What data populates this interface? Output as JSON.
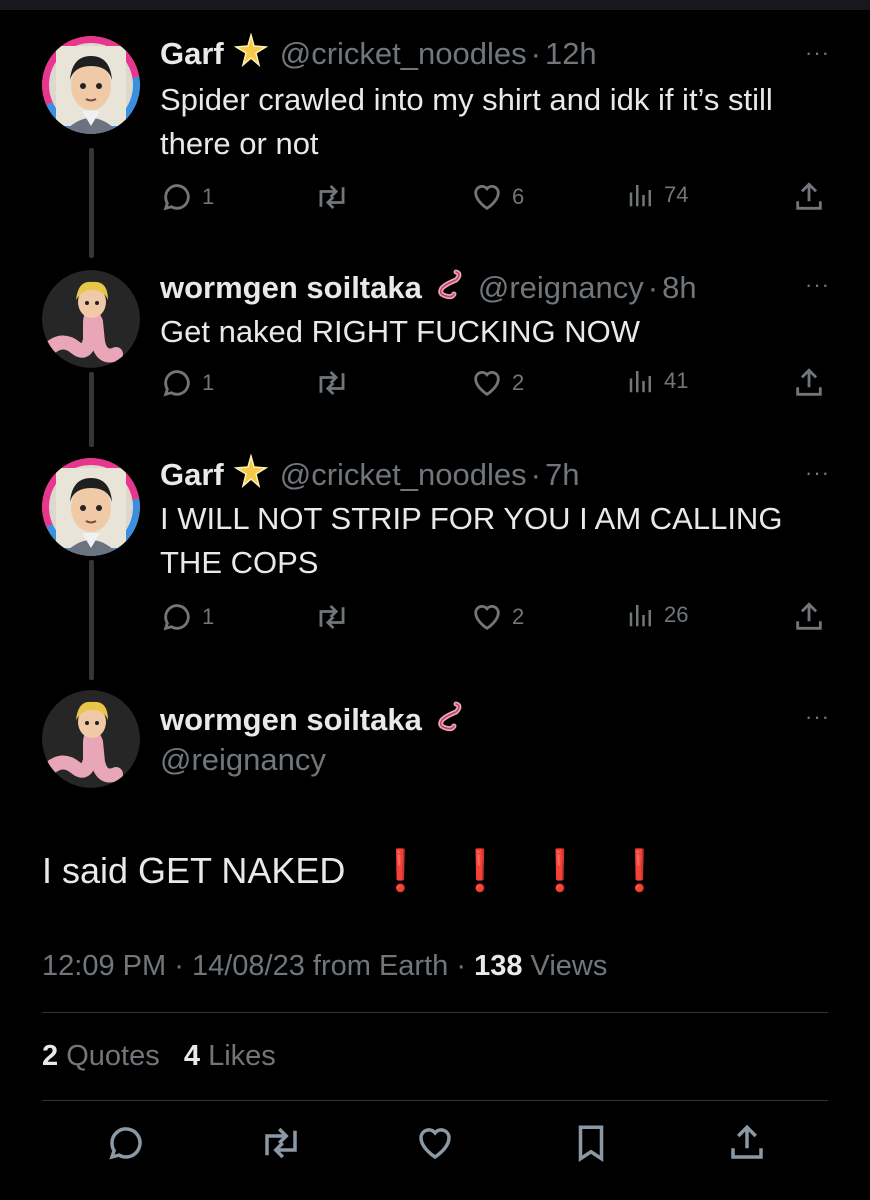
{
  "colors": {
    "background": "#000000",
    "text": "#e7e9ea",
    "muted": "#71767b",
    "divider": "#2f3336",
    "exclaim": "#e0202a"
  },
  "tweets": [
    {
      "name": "Garf",
      "badge_icon": "sparkle-star-icon",
      "handle": "@cricket_noodles",
      "time": "12h",
      "text": "Spider crawled into my shirt and idk if it’s still there or not",
      "replies": "1",
      "likes": "6",
      "views": "74"
    },
    {
      "name": "wormgen soiltaka",
      "badge_icon": "worm-icon",
      "handle": "@reignancy",
      "time": "8h",
      "text": "Get naked RIGHT FUCKING NOW",
      "replies": "1",
      "likes": "2",
      "views": "41"
    },
    {
      "name": "Garf",
      "badge_icon": "sparkle-star-icon",
      "handle": "@cricket_noodles",
      "time": "7h",
      "text": "I WILL NOT STRIP FOR YOU I AM CALLING THE COPS",
      "replies": "1",
      "likes": "2",
      "views": "26"
    }
  ],
  "main": {
    "name": "wormgen soiltaka",
    "badge_icon": "worm-icon",
    "handle": "@reignancy",
    "text": "I said GET NAKED",
    "exclamation_count": 4,
    "time": "12:09 PM",
    "date": "14/08/23",
    "source": "from Earth",
    "views_count": "138",
    "views_label": "Views",
    "quotes_count": "2",
    "quotes_label": "Quotes",
    "likes_count": "4",
    "likes_label": "Likes"
  },
  "separator": "·",
  "more_label": "···",
  "exclamation_glyph": "❗"
}
